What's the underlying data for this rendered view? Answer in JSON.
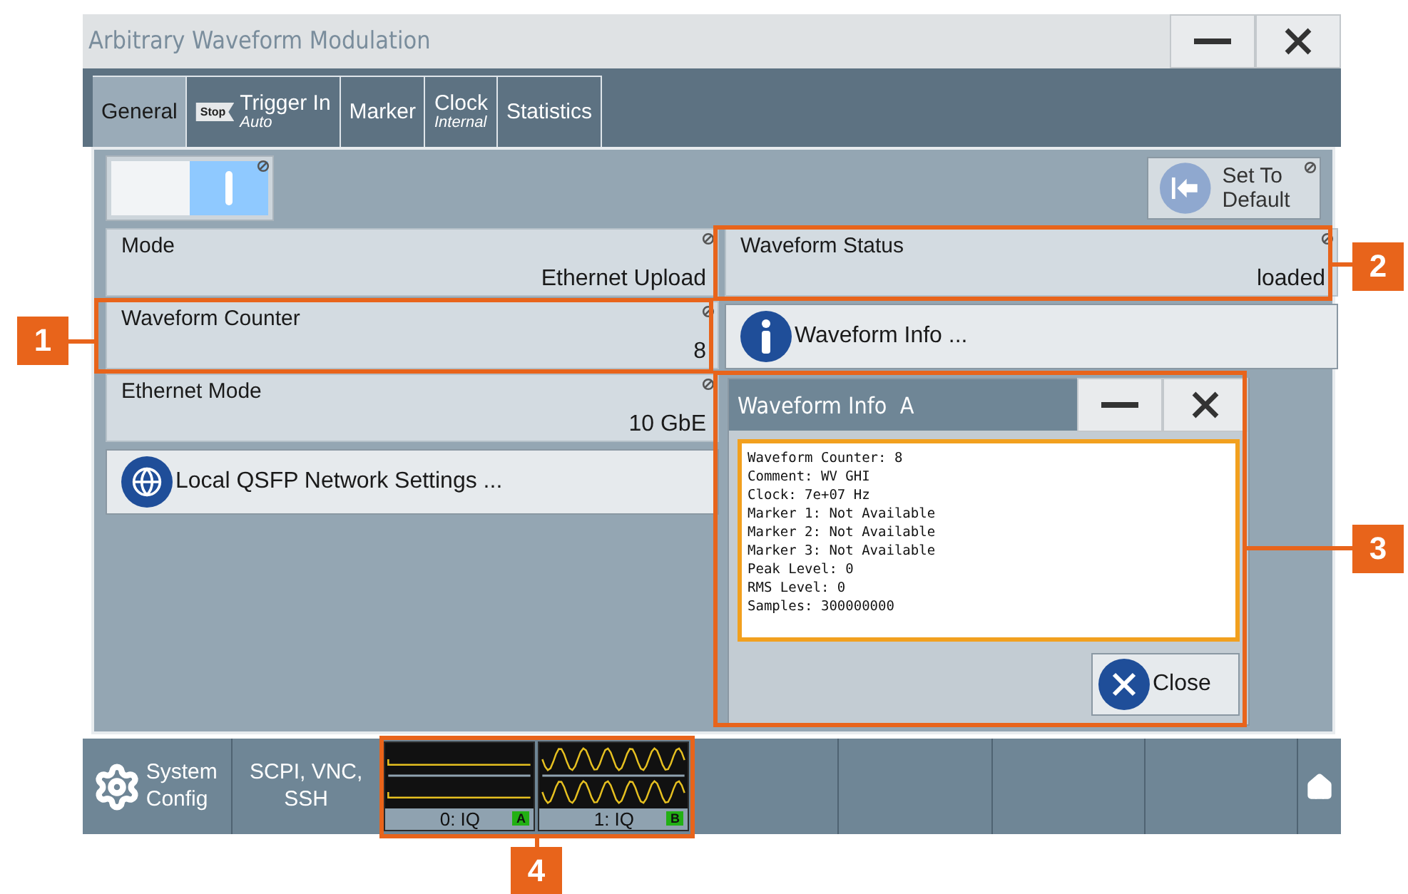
{
  "window": {
    "title": "Arbitrary Waveform Modulation"
  },
  "tabs": [
    {
      "label": "General",
      "selected": true
    },
    {
      "label": "Trigger In",
      "sublabel": "Auto",
      "badge": "Stop",
      "selected": false
    },
    {
      "label": "Marker",
      "selected": false
    },
    {
      "label": "Clock",
      "sublabel": "Internal",
      "selected": false
    },
    {
      "label": "Statistics",
      "selected": false
    }
  ],
  "toggle": {
    "on": true
  },
  "set_default_button": {
    "label": "Set To Default"
  },
  "left_column": [
    {
      "kind": "field",
      "label": "Mode",
      "value": "Ethernet Upload"
    },
    {
      "kind": "field",
      "label": "Waveform Counter",
      "value": "8",
      "callout": "1"
    },
    {
      "kind": "field",
      "label": "Ethernet Mode",
      "value": "10 GbE"
    },
    {
      "kind": "button",
      "label": "Local QSFP Network Settings ..."
    }
  ],
  "right_column": [
    {
      "kind": "field",
      "label": "Waveform Status",
      "value": "loaded",
      "callout": "2"
    },
    {
      "kind": "button",
      "label": "Waveform Info ..."
    }
  ],
  "dialog": {
    "title": "Waveform Info  A",
    "callout": "3",
    "lines": [
      "Waveform Counter: 8",
      "Comment: WV GHI",
      "Clock: 7e+07 Hz",
      "Marker 1: Not Available",
      "Marker 2: Not Available",
      "Marker 3: Not Available",
      "Peak Level: 0",
      "RMS Level: 0",
      "Samples: 300000000"
    ],
    "close_button": "Close"
  },
  "taskbar": {
    "system_config": "System Config",
    "remote": "SCPI, VNC, SSH",
    "diagram": {
      "callout": "4",
      "blocks": [
        {
          "label": "0: IQ",
          "badge": "A",
          "signal": false
        },
        {
          "label": "1: IQ",
          "badge": "B",
          "signal": true
        }
      ]
    }
  }
}
